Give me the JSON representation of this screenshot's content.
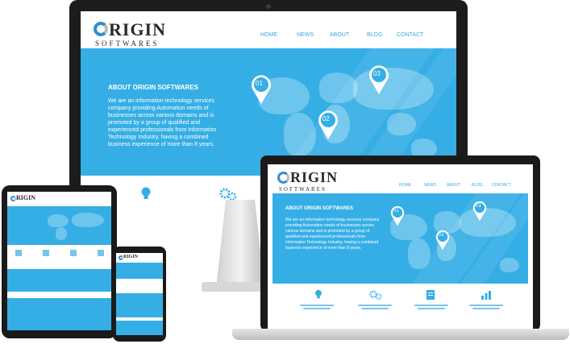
{
  "brand": {
    "name": "ORIGIN",
    "name_rest": "RIGIN",
    "tagline": "SOFTWARES"
  },
  "nav": [
    "HOME",
    "NEWS",
    "ABOUT",
    "BLOG",
    "CONTACT"
  ],
  "hero": {
    "title": "ABOUT ORIGIN SOFTWARES",
    "body": "We are an information technology services company providing Automation needs of businesses across various domains and is promoted by a group of qualified and experienced professionals from Information Technology Industry, having a combined business experience of more than 8 years."
  },
  "pins": [
    "01",
    "02",
    "03"
  ],
  "features": [
    "lightbulb-icon",
    "gears-icon",
    "document-icon",
    "chart-icon"
  ],
  "colors": {
    "accent": "#35aee6",
    "nav": "#3aa9e0",
    "bezel": "#1a1a1a"
  }
}
